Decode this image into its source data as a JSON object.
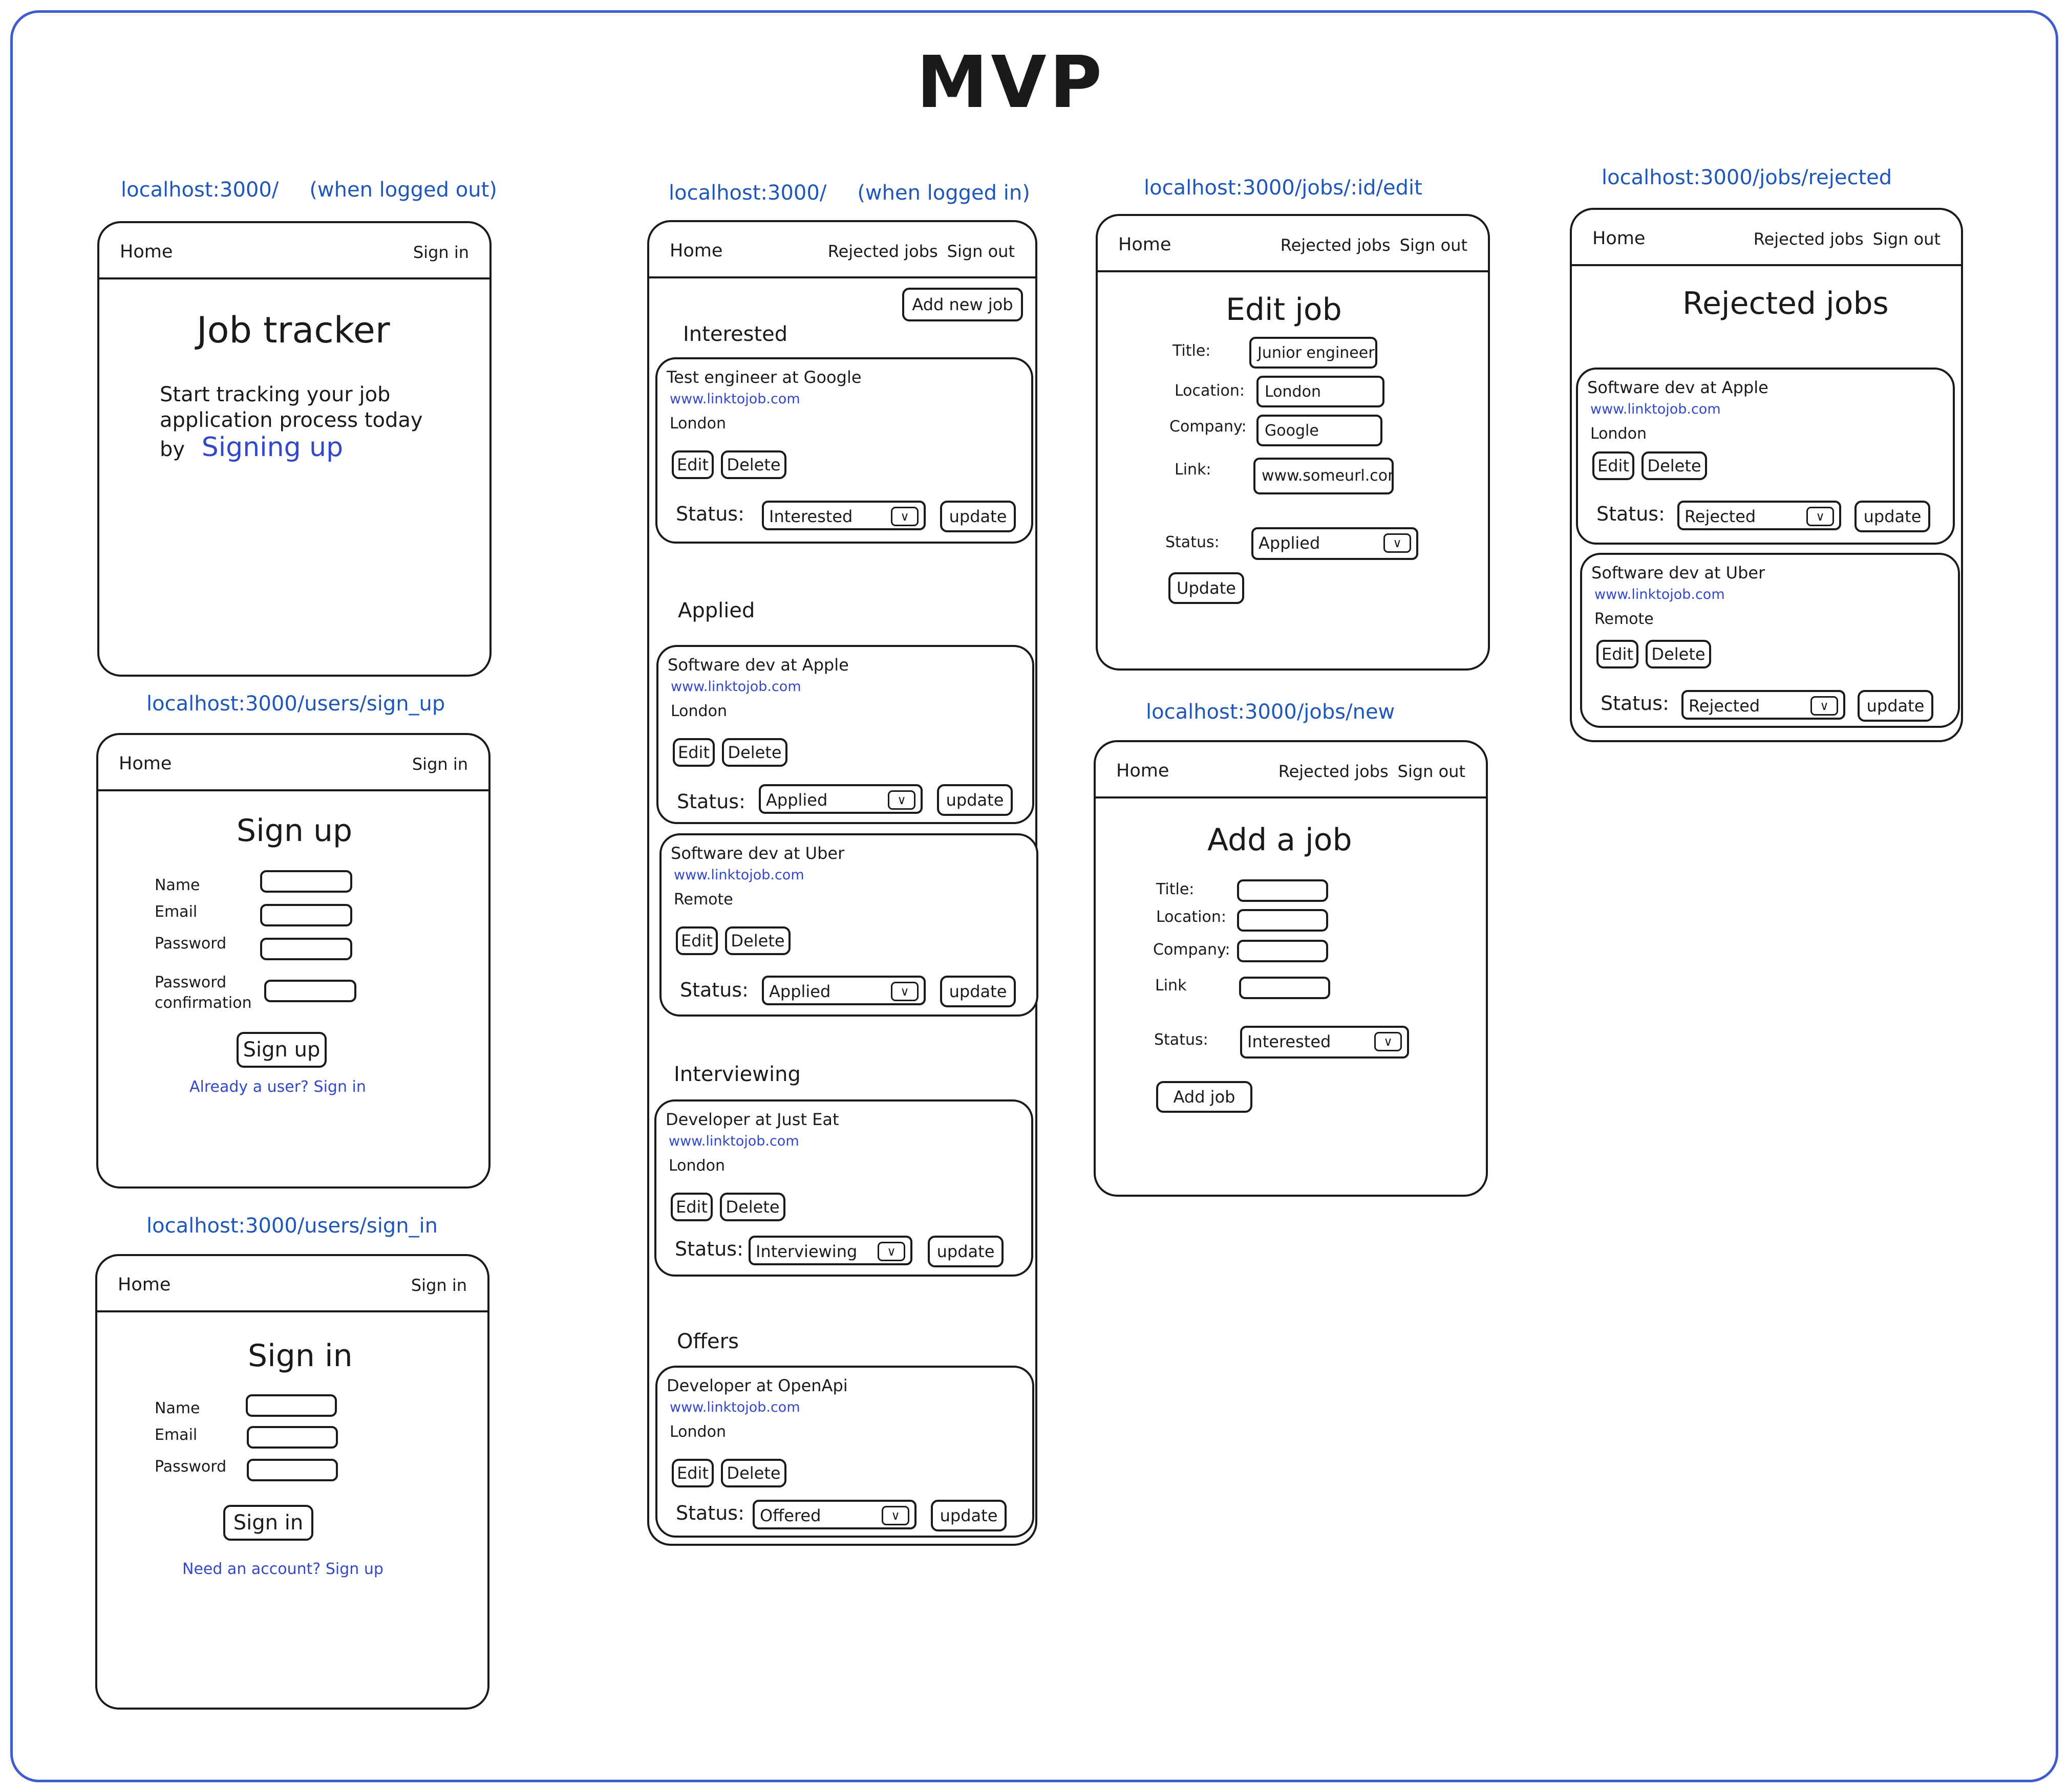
{
  "title": "MVP",
  "colors": {
    "frame_border": "#3f5bd0",
    "url_text": "#1e57b8",
    "link_text": "#3148c8",
    "ink": "#1a1a1a"
  },
  "icons": {
    "dropdown": "chevron-down-icon"
  },
  "nav": {
    "home": "Home",
    "sign_in": "Sign in",
    "rejected_jobs": "Rejected jobs",
    "sign_out": "Sign out"
  },
  "card_common": {
    "edit": "Edit",
    "delete": "Delete",
    "status_label": "Status:",
    "update": "update"
  },
  "landing": {
    "url": "localhost:3000/",
    "note": "(when logged out)",
    "heading": "Job tracker",
    "line1": "Start tracking your job",
    "line2": "application process today",
    "by": "by",
    "signing_up": "Signing up"
  },
  "signup": {
    "url": "localhost:3000/users/sign_up",
    "heading": "Sign up",
    "name": "Name",
    "email": "Email",
    "password": "Password",
    "password_confirmation_1": "Password",
    "password_confirmation_2": "confirmation",
    "button": "Sign up",
    "link": "Already a user? Sign in"
  },
  "signin": {
    "url": "localhost:3000/users/sign_in",
    "heading": "Sign in",
    "name": "Name",
    "email": "Email",
    "password": "Password",
    "button": "Sign in",
    "link": "Need an account? Sign up"
  },
  "dashboard": {
    "url": "localhost:3000/",
    "note": "(when logged in)",
    "add_new_job": "Add new job",
    "sections": {
      "interested": "Interested",
      "applied": "Applied",
      "interviewing": "Interviewing",
      "offers": "Offers"
    },
    "jobs": [
      {
        "title": "Test engineer at Google",
        "url": "www.linktojob.com",
        "location": "London",
        "status": "Interested"
      },
      {
        "title": "Software dev at Apple",
        "url": "www.linktojob.com",
        "location": "London",
        "status": "Applied"
      },
      {
        "title": "Software dev at Uber",
        "url": "www.linktojob.com",
        "location": "Remote",
        "status": "Applied"
      },
      {
        "title": "Developer at Just Eat",
        "url": "www.linktojob.com",
        "location": "London",
        "status": "Interviewing"
      },
      {
        "title": "Developer at OpenApi",
        "url": "www.linktojob.com",
        "location": "London",
        "status": "Offered"
      }
    ]
  },
  "edit_job": {
    "url": "localhost:3000/jobs/:id/edit",
    "heading": "Edit job",
    "title_label": "Title:",
    "title_value": "Junior engineer",
    "location_label": "Location:",
    "location_value": "London",
    "company_label": "Company:",
    "company_value": "Google",
    "link_label": "Link:",
    "link_value": "www.someurl.com",
    "status_label": "Status:",
    "status_value": "Applied",
    "button": "Update"
  },
  "new_job": {
    "url": "localhost:3000/jobs/new",
    "heading": "Add a job",
    "title_label": "Title:",
    "location_label": "Location:",
    "company_label": "Company:",
    "link_label": "Link",
    "status_label": "Status:",
    "status_value": "Interested",
    "button": "Add job"
  },
  "rejected": {
    "url": "localhost:3000/jobs/rejected",
    "heading": "Rejected jobs",
    "jobs": [
      {
        "title": "Software dev at Apple",
        "url": "www.linktojob.com",
        "location": "London",
        "status": "Rejected"
      },
      {
        "title": "Software dev at Uber",
        "url": "www.linktojob.com",
        "location": "Remote",
        "status": "Rejected"
      }
    ]
  }
}
